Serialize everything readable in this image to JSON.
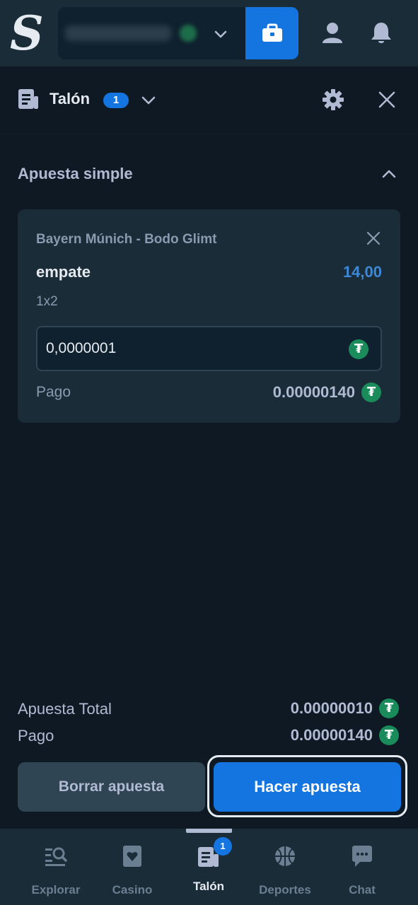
{
  "header": {
    "logo": "S",
    "icons": [
      "wallet-icon",
      "user-icon",
      "bell-icon"
    ]
  },
  "betslip": {
    "title": "Talón",
    "count": "1",
    "section_title": "Apuesta simple",
    "bet": {
      "match": "Bayern Múnich - Bodo Glimt",
      "selection": "empate",
      "odds": "14,00",
      "market": "1x2",
      "stake": "0,0000001",
      "payout_label": "Pago",
      "payout_value": "0.00000140",
      "currency_icon": "tether-icon"
    },
    "totals": {
      "stake_label": "Apuesta Total",
      "stake_value": "0.00000010",
      "payout_label": "Pago",
      "payout_value": "0.00000140"
    },
    "clear_button": "Borrar apuesta",
    "place_button": "Hacer apuesta"
  },
  "nav": {
    "items": [
      {
        "label": "Explorar",
        "icon": "explore-icon"
      },
      {
        "label": "Casino",
        "icon": "cards-icon"
      },
      {
        "label": "Talón",
        "icon": "betslip-icon",
        "badge": "1"
      },
      {
        "label": "Deportes",
        "icon": "basketball-icon"
      },
      {
        "label": "Chat",
        "icon": "chat-icon"
      }
    ]
  },
  "colors": {
    "background": "#0f1923",
    "surface": "#1a2c38",
    "accent": "#1475e1",
    "tether": "#1a8c5c"
  }
}
